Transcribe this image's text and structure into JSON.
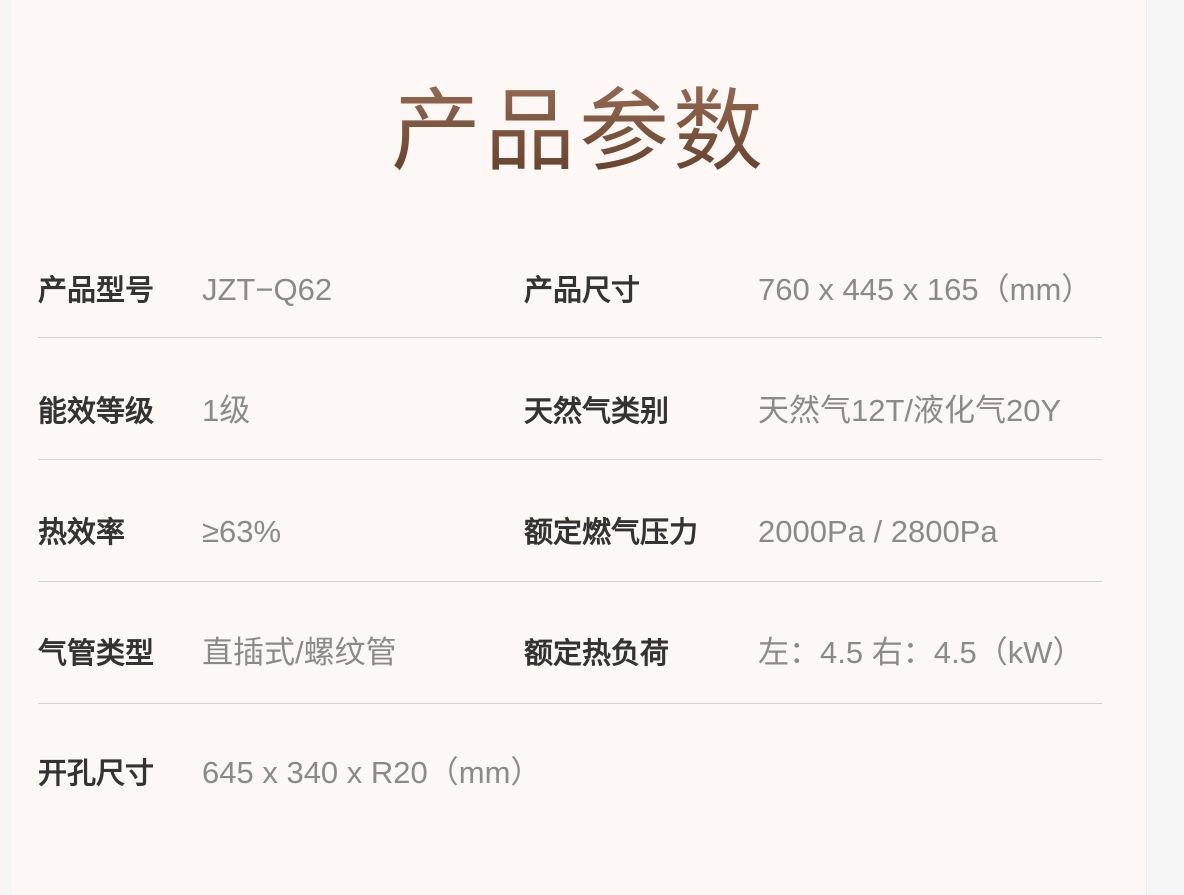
{
  "title": "产品参数",
  "specs": [
    {
      "left_label": "产品型号",
      "left_value": "JZT−Q62",
      "right_label": "产品尺寸",
      "right_value": "760 x 445 x 165（mm）"
    },
    {
      "left_label": "能效等级",
      "left_value": "1级",
      "right_label": "天然气类别",
      "right_value": "天然气12T/液化气20Y"
    },
    {
      "left_label": "热效率",
      "left_value": "≥63%",
      "right_label": "额定燃气压力",
      "right_value": "2000Pa / 2800Pa"
    },
    {
      "left_label": "气管类型",
      "left_value": "直插式/螺纹管",
      "right_label": "额定热负荷",
      "right_value": "左：4.5  右：4.5（kW）"
    },
    {
      "left_label": "开孔尺寸",
      "left_value": "645 x 340 x R20（mm）"
    }
  ]
}
